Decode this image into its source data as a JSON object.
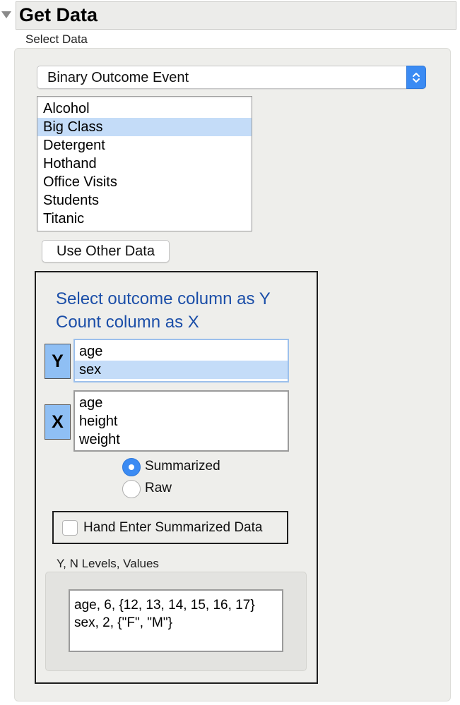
{
  "header": {
    "title": "Get Data",
    "section_label": "Select Data"
  },
  "dropdown": {
    "selected": "Binary Outcome Event"
  },
  "data_tables": {
    "items": [
      "Alcohol",
      "Big Class",
      "Detergent",
      "Hothand",
      "Office Visits",
      "Students",
      "Titanic"
    ],
    "selected": "Big Class"
  },
  "buttons": {
    "use_other_data": "Use Other Data"
  },
  "roles": {
    "instruction_line1": "Select outcome column as Y",
    "instruction_line2": "Count column as X",
    "y_button": "Y",
    "x_button": "X",
    "y_columns": [
      "age",
      "sex"
    ],
    "y_selected": "sex",
    "x_columns": [
      "age",
      "height",
      "weight"
    ]
  },
  "mode": {
    "summarized_label": "Summarized",
    "raw_label": "Raw",
    "selected": "Summarized"
  },
  "hand_enter": {
    "label": "Hand Enter Summarized Data",
    "checked": false
  },
  "levels": {
    "label": "Y, N Levels, Values",
    "lines": [
      "age, 6, {12, 13, 14, 15, 16, 17}",
      "sex, 2, {\"F\", \"M\"}"
    ]
  },
  "colors": {
    "accent": "#3b8bf3",
    "selection": "#c4dcf8",
    "instruction_text": "#1b4ea8",
    "role_button": "#8fbff4"
  }
}
